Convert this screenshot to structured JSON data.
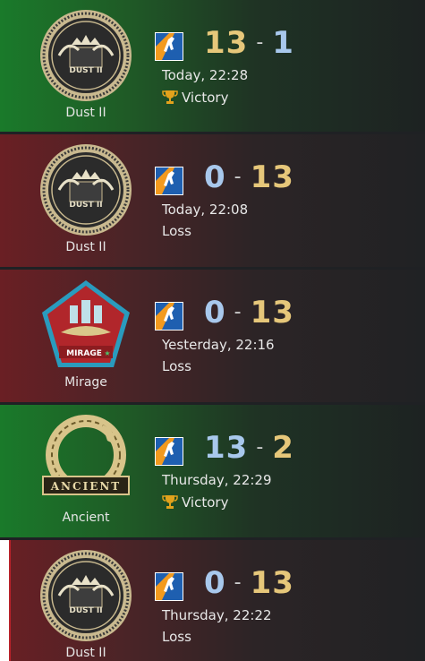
{
  "matches": [
    {
      "map": "Dust II",
      "emblem": "dust2-emblem-icon",
      "mode_icon": "competitive-mode-icon",
      "own_score": "13",
      "opp_score": "1",
      "date": "Today, 22:28",
      "result": "Victory",
      "outcome": "win"
    },
    {
      "map": "Dust II",
      "emblem": "dust2-emblem-icon",
      "mode_icon": "competitive-mode-icon",
      "own_score": "0",
      "opp_score": "13",
      "date": "Today, 22:08",
      "result": "Loss",
      "outcome": "loss"
    },
    {
      "map": "Mirage",
      "emblem": "mirage-emblem-icon",
      "mode_icon": "competitive-mode-icon",
      "own_score": "0",
      "opp_score": "13",
      "date": "Yesterday, 22:16",
      "result": "Loss",
      "outcome": "loss"
    },
    {
      "map": "Ancient",
      "emblem": "ancient-emblem-icon",
      "mode_icon": "competitive-mode-icon",
      "own_score": "13",
      "opp_score": "2",
      "date": "Thursday, 22:29",
      "result": "Victory",
      "outcome": "win"
    },
    {
      "map": "Dust II",
      "emblem": "dust2-emblem-icon",
      "mode_icon": "competitive-mode-icon",
      "own_score": "0",
      "opp_score": "13",
      "date": "Thursday, 22:22",
      "result": "Loss",
      "outcome": "loss"
    }
  ],
  "emblem_text": {
    "dust2": "DUST II",
    "mirage": "MIRAGE",
    "ancient": "ANCIENT"
  },
  "colors": {
    "win": "#1a7a2a",
    "loss": "#6a1f24",
    "score_gold": "#e6c77a",
    "score_blue": "#a8c8ec",
    "mode_icon_orange": "#f39a1e",
    "mode_icon_blue": "#1e5fb0"
  }
}
